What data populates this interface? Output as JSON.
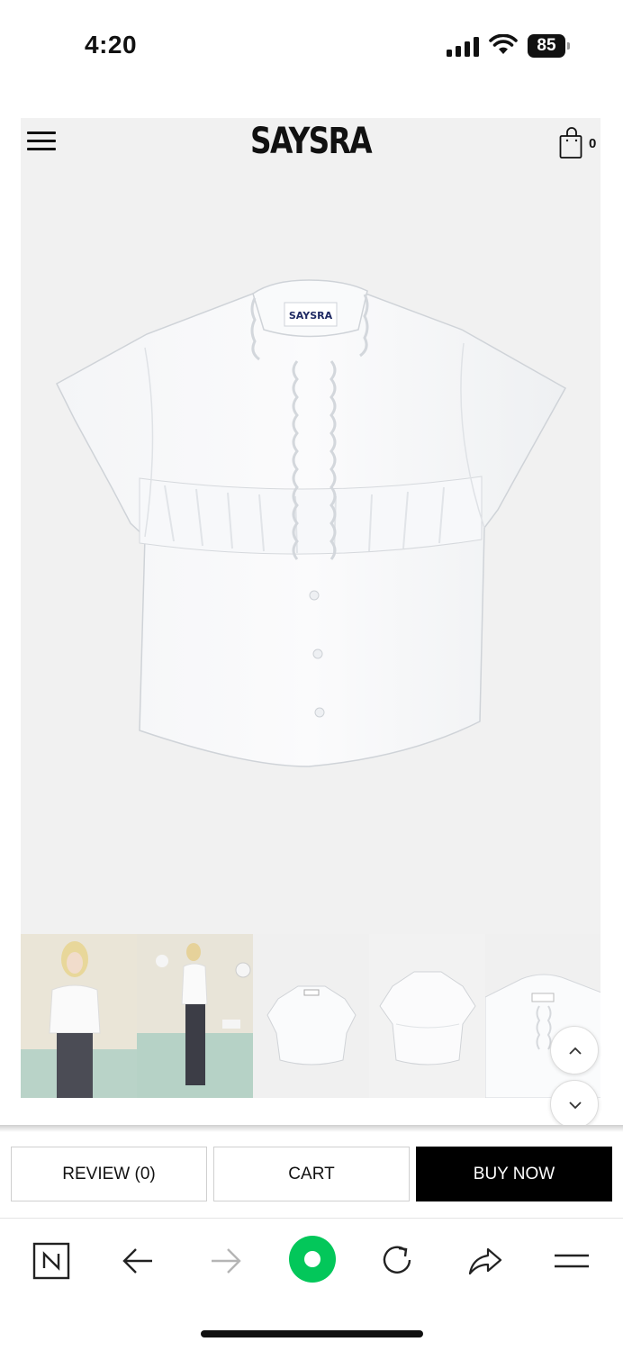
{
  "status_bar": {
    "time": "4:20",
    "battery_level": "85"
  },
  "header": {
    "brand": "SAYSRA",
    "cart_count": "0",
    "menu_icon": "hamburger-icon",
    "cart_icon": "shopping-bag-icon"
  },
  "product": {
    "main_image": "white-ruffle-collar-short-sleeve-blouse",
    "label_text": "SAYSRA",
    "thumbnails": [
      "model-front",
      "model-side",
      "flat-front",
      "flat-back",
      "collar-detail"
    ]
  },
  "scroll_controls": {
    "up_icon": "chevron-up-icon",
    "down_icon": "chevron-down-icon"
  },
  "actions": {
    "review_label": "REVIEW (0)",
    "cart_label": "CART",
    "buy_label": "BUY NOW"
  },
  "browser_toolbar": {
    "items": [
      "naver-n-icon",
      "back-arrow-icon",
      "forward-arrow-icon",
      "home-green-icon",
      "refresh-icon",
      "share-icon",
      "menu-icon"
    ]
  },
  "colors": {
    "accent_green": "#03c75a",
    "buy_button": "#000000",
    "product_bg": "#f1f1f1"
  }
}
